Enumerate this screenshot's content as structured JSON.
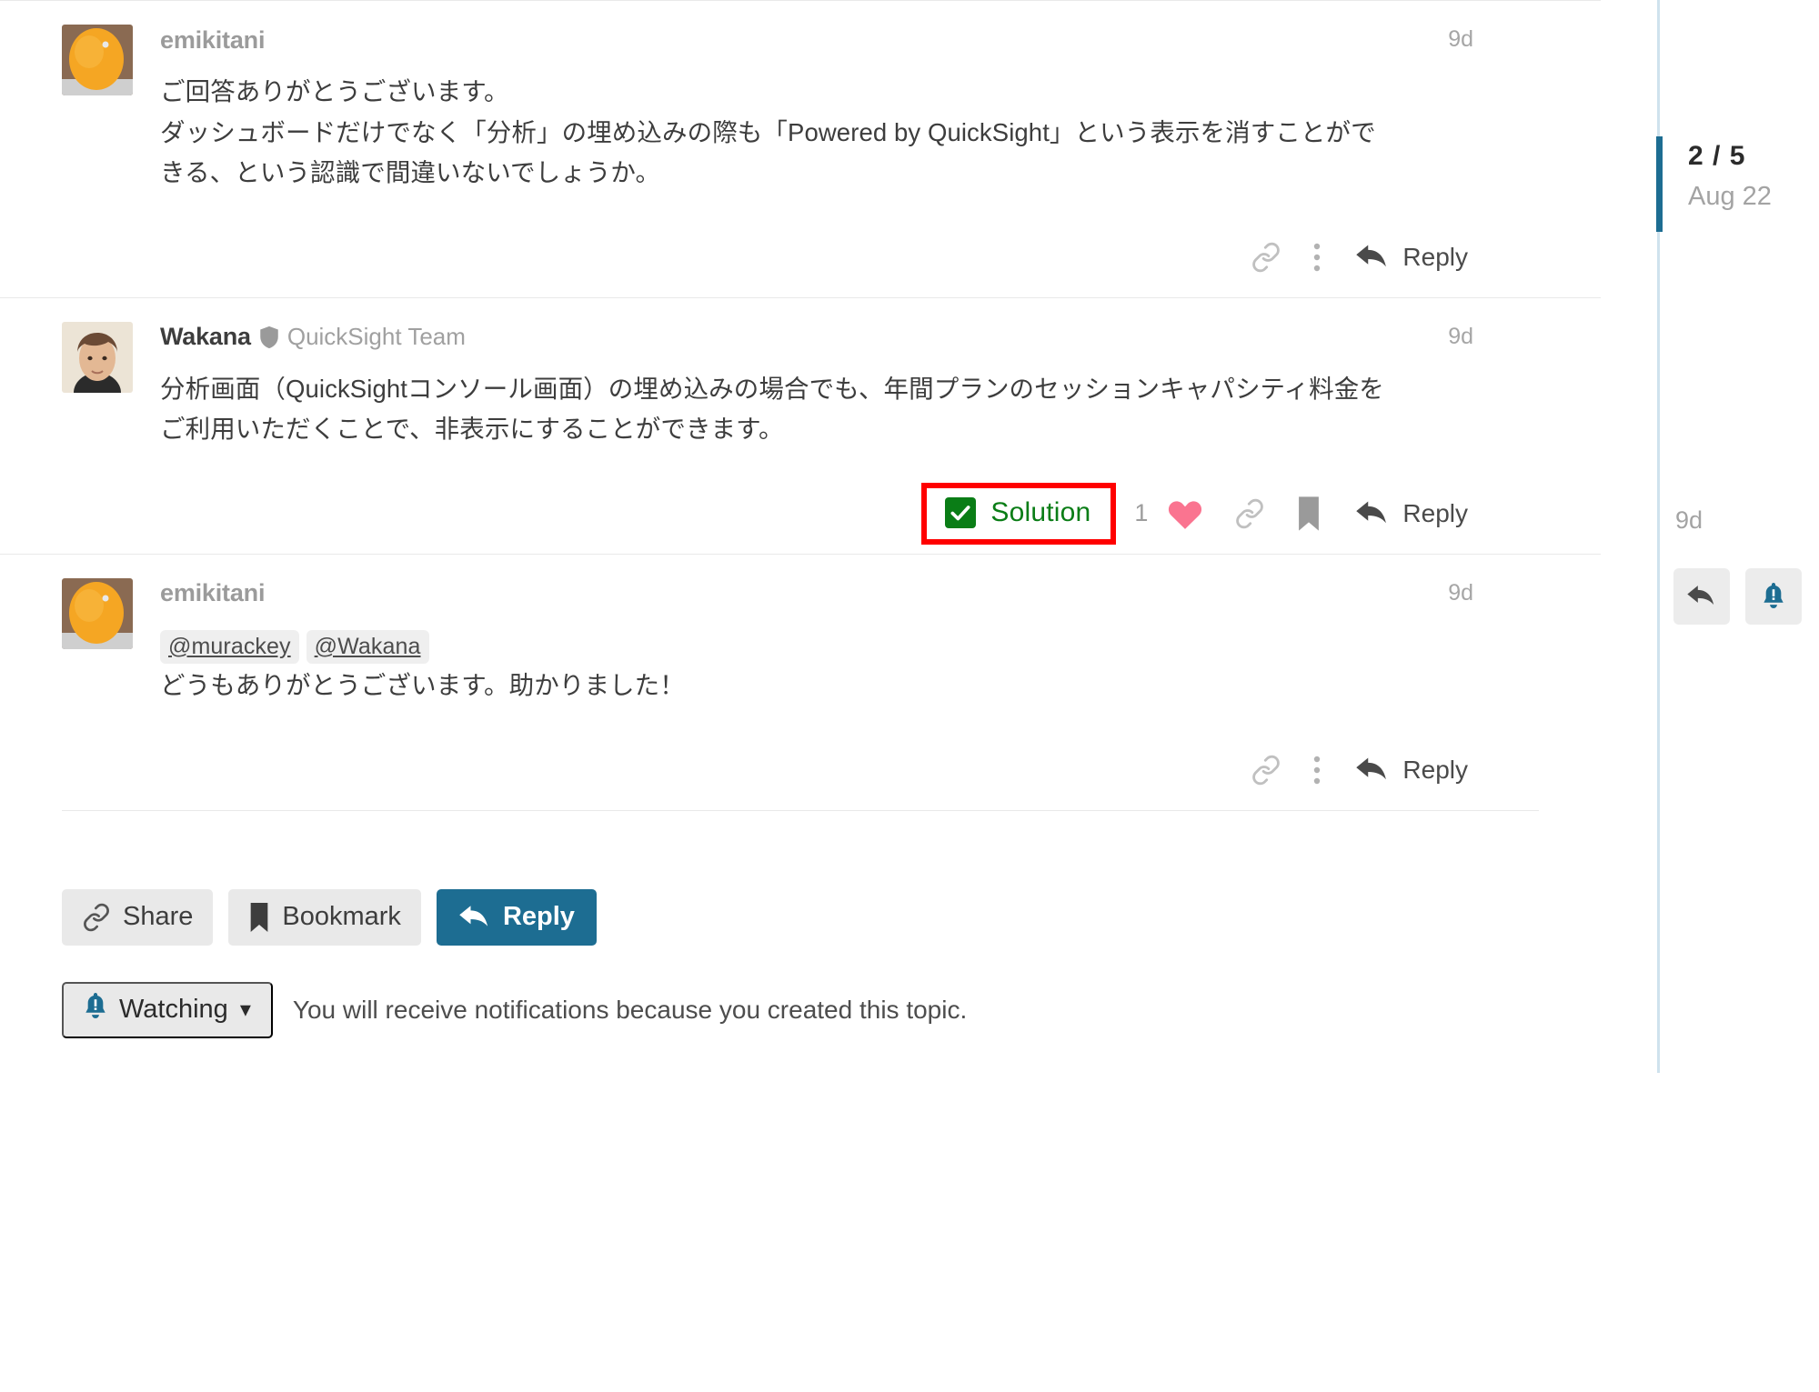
{
  "posts": [
    {
      "username": "emikitani",
      "user_title": "",
      "has_shield": false,
      "date": "9d",
      "avatar": "orange-fruit-avatar",
      "body_lines": [
        "ご回答ありがとうございます。",
        "ダッシュボードだけでなく「分析」の埋め込みの際も「Powered by QuickSight」という表示を消すことがで",
        "きる、という認識で間違いないでしょうか。"
      ],
      "mentions": [],
      "actions": {
        "link_icon": "link-icon",
        "more_icon": "ellipsis-vertical-icon",
        "reply_icon": "reply-arrow-icon",
        "reply_label": "Reply"
      },
      "has_solution": false
    },
    {
      "username": "Wakana",
      "user_title": "QuickSight Team",
      "has_shield": true,
      "date": "9d",
      "avatar": "woman-photo-avatar",
      "body_lines": [
        "分析画面（QuickSightコンソール画面）の埋め込みの場合でも、年間プランのセッションキャパシティ料金を",
        "ご利用いただくことで、非表示にすることができます。"
      ],
      "mentions": [],
      "actions": {
        "solution_label": "Solution",
        "like_count": "1",
        "heart_icon": "heart-icon",
        "link_icon": "link-icon",
        "bookmark_icon": "bookmark-icon",
        "reply_icon": "reply-arrow-icon",
        "reply_label": "Reply"
      },
      "has_solution": true
    },
    {
      "username": "emikitani",
      "user_title": "",
      "has_shield": false,
      "date": "9d",
      "avatar": "orange-fruit-avatar",
      "body_lines": [
        "どうもありがとうございます。助かりました！"
      ],
      "mentions": [
        "@murackey",
        "@Wakana"
      ],
      "actions": {
        "link_icon": "link-icon",
        "more_icon": "ellipsis-vertical-icon",
        "reply_icon": "reply-arrow-icon",
        "reply_label": "Reply"
      },
      "has_solution": false
    }
  ],
  "footer": {
    "share_label": "Share",
    "bookmark_label": "Bookmark",
    "reply_label": "Reply",
    "share_icon": "link-icon",
    "bookmark_icon": "bookmark-icon",
    "reply_icon": "reply-arrow-icon",
    "watching_label": "Watching",
    "watching_icon": "bell-exclamation-icon",
    "watching_chevron": "chevron-down-icon",
    "notification_reason": "You will receive notifications because you created this topic."
  },
  "timeline": {
    "position": "2 / 5",
    "date": "Aug 22",
    "last_activity": "9d",
    "reply_icon": "reply-arrow-icon",
    "notification_icon": "bell-exclamation-icon"
  },
  "colors": {
    "accent": "#1d6d92",
    "solution_green": "#0a7d16",
    "highlight_red": "#ff0000",
    "heart_pink": "#fa7490",
    "timeline_rail": "#cfe2ed"
  }
}
